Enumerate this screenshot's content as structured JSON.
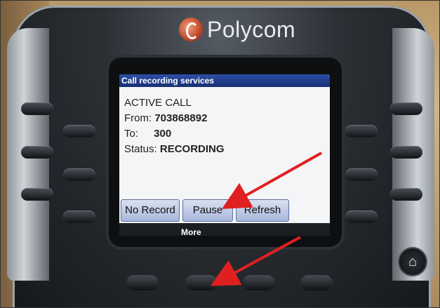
{
  "brand": {
    "name": "Polycom"
  },
  "screen": {
    "title": "Call recording services",
    "status_line": "ACTIVE CALL",
    "from_label": "From:",
    "from_value": "703868892",
    "to_label": "To:",
    "to_value": "300",
    "status_label": "Status:",
    "status_value": "RECORDING"
  },
  "softkeys": {
    "no_record": "No Record",
    "pause": "Pause",
    "refresh": "Refresh",
    "more": "More"
  },
  "icons": {
    "brand": "polycom-logo-icon",
    "home": "home-icon",
    "annotation": "red-arrow-icon"
  },
  "colors": {
    "annotation_arrow": "#e02020",
    "header_bar": "#2b4ea6",
    "softkey_fill": "#c4cfea"
  }
}
